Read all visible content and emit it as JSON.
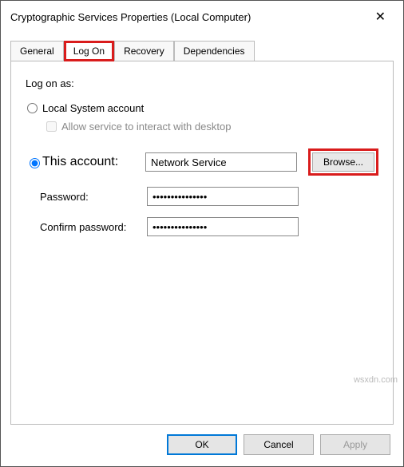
{
  "window": {
    "title": "Cryptographic Services Properties (Local Computer)"
  },
  "tabs": {
    "general": "General",
    "logon": "Log On",
    "recovery": "Recovery",
    "dependencies": "Dependencies"
  },
  "panel": {
    "heading": "Log on as:",
    "local_system_label": "Local System account",
    "interact_label": "Allow service to interact with desktop",
    "this_account_label": "This account:",
    "account_value": "Network Service",
    "browse_label": "Browse...",
    "password_label": "Password:",
    "password_value": "•••••••••••••••",
    "confirm_label": "Confirm password:",
    "confirm_value": "•••••••••••••••"
  },
  "buttons": {
    "ok": "OK",
    "cancel": "Cancel",
    "apply": "Apply"
  },
  "watermark": "wsxdn.com"
}
